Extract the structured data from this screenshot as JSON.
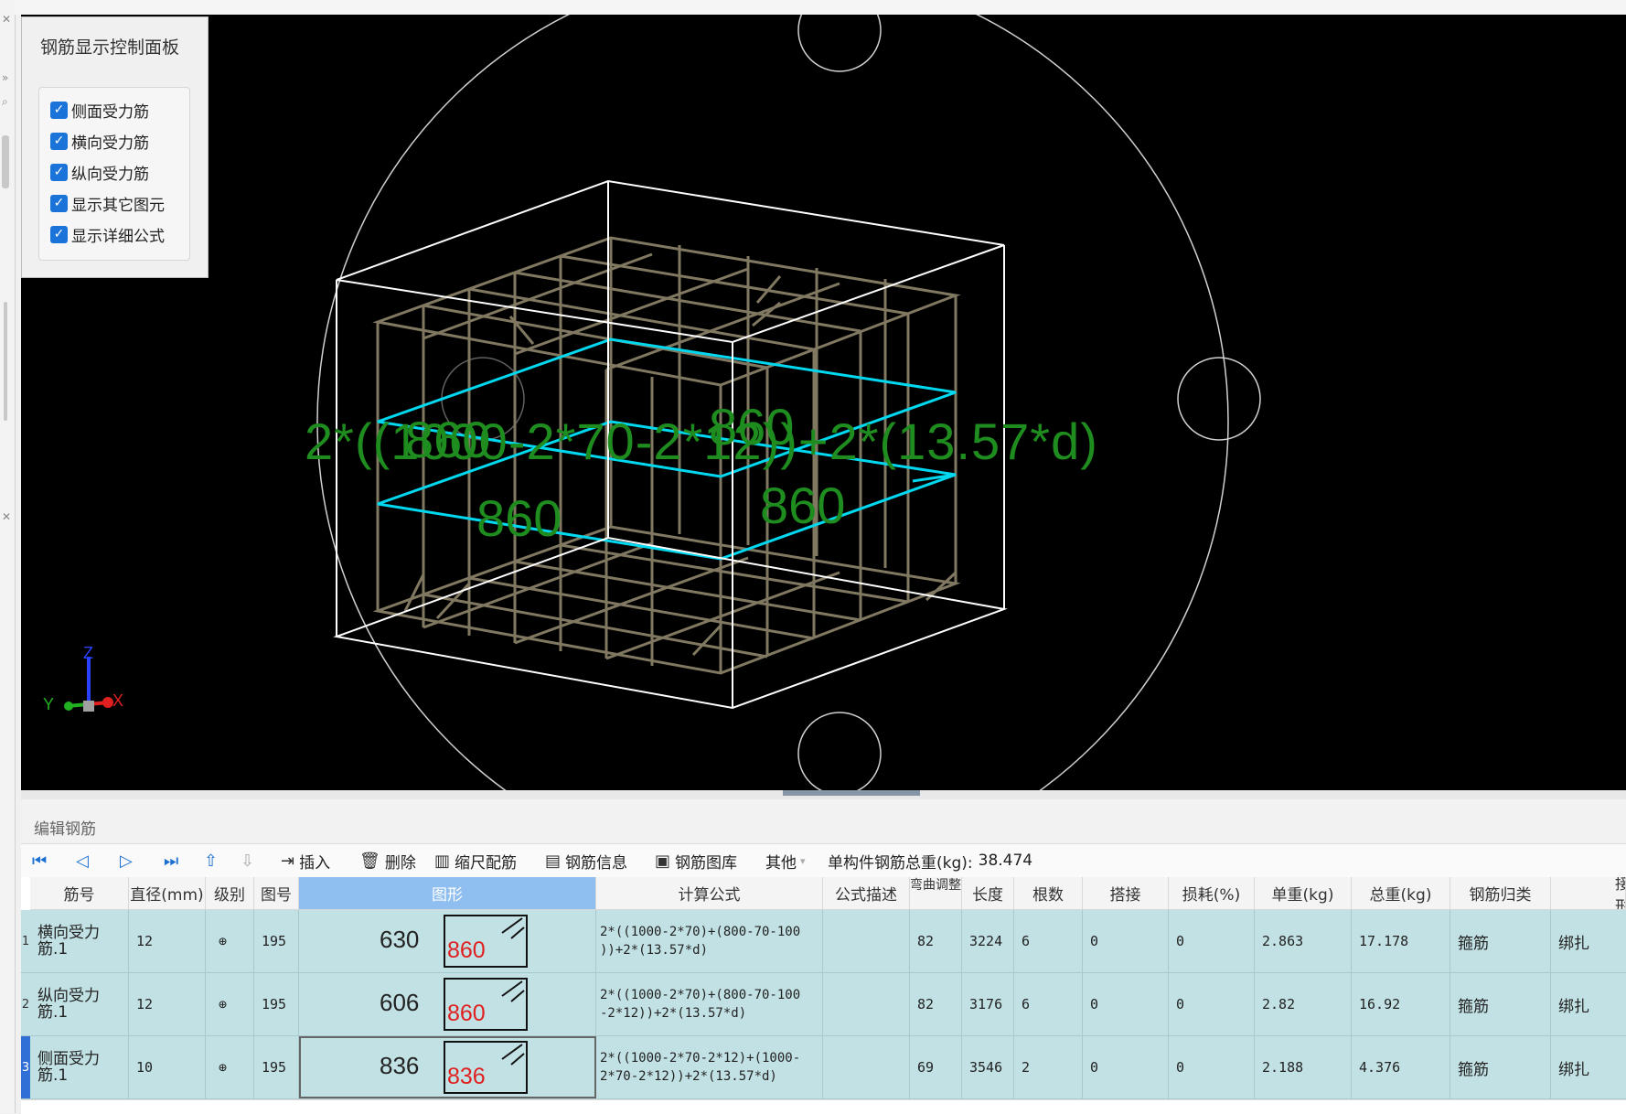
{
  "control_panel": {
    "title": "钢筋显示控制面板",
    "options": [
      {
        "label": "侧面受力筋",
        "checked": true
      },
      {
        "label": "横向受力筋",
        "checked": true
      },
      {
        "label": "纵向受力筋",
        "checked": true
      },
      {
        "label": "显示其它图元",
        "checked": true
      },
      {
        "label": "显示详细公式",
        "checked": true
      }
    ]
  },
  "viewport": {
    "overlay_formula": "2*((1000-2*70-2*12))+2*(13.57*d)",
    "dim_labels": [
      "860",
      "860",
      "860",
      "860"
    ],
    "axis": {
      "z": "Z",
      "y": "Y",
      "x": "X"
    }
  },
  "editor": {
    "title": "编辑钢筋",
    "toolbar": {
      "first_icon": "first-record-icon",
      "prev_icon": "prev-record-icon",
      "next_icon": "next-record-icon",
      "last_icon": "last-record-icon",
      "move_up_icon": "move-up-icon",
      "move_down_icon": "move-down-icon",
      "insert": "插入",
      "delete": "删除",
      "scale_rebar": "缩尺配筋",
      "rebar_info": "钢筋信息",
      "rebar_library": "钢筋图库",
      "other": "其他",
      "total_weight_label": "单构件钢筋总重(kg):",
      "total_weight_value": "38.474"
    },
    "columns": [
      "筋号",
      "直径(mm)",
      "级别",
      "图号",
      "图形",
      "计算公式",
      "公式描述",
      "弯曲调整",
      "长度",
      "根数",
      "搭接",
      "损耗(%)",
      "单重(kg)",
      "总重(kg)",
      "钢筋归类",
      "搭接形式"
    ],
    "rows": [
      {
        "num": "1",
        "name": "横向受力筋.1",
        "diameter": "12",
        "grade": "⊕",
        "fig": "195",
        "shape_top": "630",
        "shape_side": "860",
        "formula": "2*((1000-2*70)+(800-70-100\n))+2*(13.57*d)",
        "desc": "",
        "bend": "82",
        "length": "3224",
        "count": "6",
        "lap": "0",
        "loss": "0",
        "unit_weight": "2.863",
        "total_weight": "17.178",
        "category": "箍筋",
        "lap_type": "绑扎"
      },
      {
        "num": "2",
        "name": "纵向受力筋.1",
        "diameter": "12",
        "grade": "⊕",
        "fig": "195",
        "shape_top": "606",
        "shape_side": "860",
        "formula": "2*((1000-2*70)+(800-70-100\n-2*12))+2*(13.57*d)",
        "desc": "",
        "bend": "82",
        "length": "3176",
        "count": "6",
        "lap": "0",
        "loss": "0",
        "unit_weight": "2.82",
        "total_weight": "16.92",
        "category": "箍筋",
        "lap_type": "绑扎"
      },
      {
        "num": "3",
        "name": "侧面受力筋.1",
        "diameter": "10",
        "grade": "⊕",
        "fig": "195",
        "shape_top": "836",
        "shape_side": "836",
        "formula": "2*((1000-2*70-2*12)+(1000-\n2*70-2*12))+2*(13.57*d)",
        "desc": "",
        "bend": "69",
        "length": "3546",
        "count": "2",
        "lap": "0",
        "loss": "0",
        "unit_weight": "2.188",
        "total_weight": "4.376",
        "category": "箍筋",
        "lap_type": "绑扎"
      }
    ]
  },
  "colors": {
    "viewport_bg": "#000000",
    "cage": "#807860",
    "hoop": "#00d8f0",
    "formula_text": "#1e8c1e",
    "row_bg": "#c2e1e4",
    "header_selected": "#8fbef0"
  }
}
